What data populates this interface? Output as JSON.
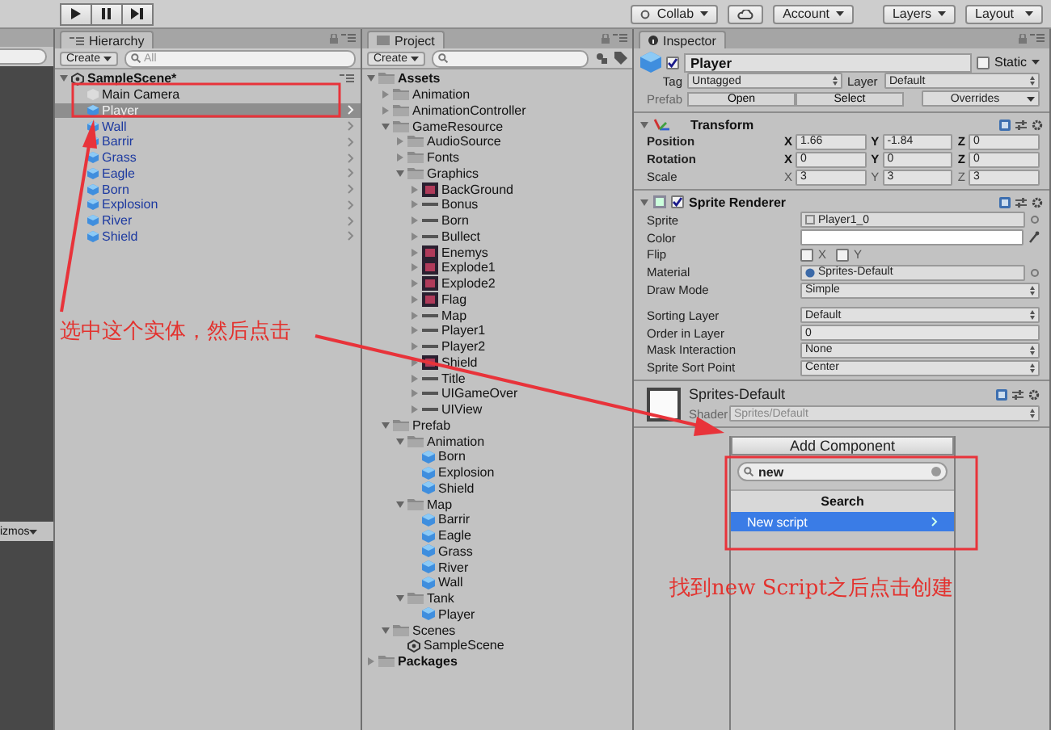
{
  "toolbar": {
    "playback": [
      {
        "kind": "play"
      },
      {
        "kind": "pause"
      },
      {
        "kind": "step"
      }
    ],
    "collab": "Collab",
    "account": "Account",
    "layers": "Layers",
    "layout": "Layout"
  },
  "scene_view": {
    "gizmos": "izmos"
  },
  "hierarchy": {
    "tab": "Hierarchy",
    "create": "Create",
    "search_placeholder": "All",
    "scene": "SampleScene*",
    "items": [
      {
        "label": "Main Camera",
        "kind": "object",
        "selected": false
      },
      {
        "label": "Player",
        "kind": "prefab",
        "selected": true
      },
      {
        "label": "Wall",
        "kind": "prefab",
        "selected": false
      },
      {
        "label": "Barrir",
        "kind": "prefab",
        "selected": false
      },
      {
        "label": "Grass",
        "kind": "prefab",
        "selected": false
      },
      {
        "label": "Eagle",
        "kind": "prefab",
        "selected": false
      },
      {
        "label": "Born",
        "kind": "prefab",
        "selected": false
      },
      {
        "label": "Explosion",
        "kind": "prefab",
        "selected": false
      },
      {
        "label": "River",
        "kind": "prefab",
        "selected": false
      },
      {
        "label": "Shield",
        "kind": "prefab",
        "selected": false
      }
    ]
  },
  "project": {
    "tab": "Project",
    "create": "Create",
    "tree": [
      {
        "label": "Assets",
        "kind": "folder",
        "expanded": true,
        "children": [
          {
            "label": "Animation",
            "kind": "folder",
            "expanded": false
          },
          {
            "label": "AnimationController",
            "kind": "folder",
            "expanded": false
          },
          {
            "label": "GameResource",
            "kind": "folder",
            "expanded": true,
            "children": [
              {
                "label": "AudioSource",
                "kind": "folder",
                "expanded": false
              },
              {
                "label": "Fonts",
                "kind": "folder",
                "expanded": false
              },
              {
                "label": "Graphics",
                "kind": "folder",
                "expanded": true,
                "children": [
                  {
                    "label": "BackGround",
                    "kind": "texture",
                    "expanded": false
                  },
                  {
                    "label": "Bonus",
                    "kind": "strip",
                    "expanded": false
                  },
                  {
                    "label": "Born",
                    "kind": "strip",
                    "expanded": false
                  },
                  {
                    "label": "Bullect",
                    "kind": "strip",
                    "expanded": false
                  },
                  {
                    "label": "Enemys",
                    "kind": "texture",
                    "expanded": false
                  },
                  {
                    "label": "Explode1",
                    "kind": "texture",
                    "expanded": false
                  },
                  {
                    "label": "Explode2",
                    "kind": "texture",
                    "expanded": false
                  },
                  {
                    "label": "Flag",
                    "kind": "texture",
                    "expanded": false
                  },
                  {
                    "label": "Map",
                    "kind": "strip",
                    "expanded": false
                  },
                  {
                    "label": "Player1",
                    "kind": "strip",
                    "expanded": false
                  },
                  {
                    "label": "Player2",
                    "kind": "strip",
                    "expanded": false
                  },
                  {
                    "label": "Shield",
                    "kind": "texture",
                    "expanded": false
                  },
                  {
                    "label": "Title",
                    "kind": "strip",
                    "expanded": false
                  },
                  {
                    "label": "UIGameOver",
                    "kind": "strip",
                    "expanded": false
                  },
                  {
                    "label": "UIView",
                    "kind": "strip",
                    "expanded": false
                  }
                ]
              }
            ]
          },
          {
            "label": "Prefab",
            "kind": "folder",
            "expanded": true,
            "children": [
              {
                "label": "Animation",
                "kind": "folder",
                "expanded": true,
                "children": [
                  {
                    "label": "Born",
                    "kind": "prefab"
                  },
                  {
                    "label": "Explosion",
                    "kind": "prefab"
                  },
                  {
                    "label": "Shield",
                    "kind": "prefab"
                  }
                ]
              },
              {
                "label": "Map",
                "kind": "folder",
                "expanded": true,
                "children": [
                  {
                    "label": "Barrir",
                    "kind": "prefab"
                  },
                  {
                    "label": "Eagle",
                    "kind": "prefab"
                  },
                  {
                    "label": "Grass",
                    "kind": "prefab"
                  },
                  {
                    "label": "River",
                    "kind": "prefab"
                  },
                  {
                    "label": "Wall",
                    "kind": "prefab"
                  }
                ]
              },
              {
                "label": "Tank",
                "kind": "folder",
                "expanded": true,
                "children": [
                  {
                    "label": "Player",
                    "kind": "prefab"
                  }
                ]
              }
            ]
          },
          {
            "label": "Scenes",
            "kind": "folder",
            "expanded": true,
            "children": [
              {
                "label": "SampleScene",
                "kind": "scene"
              }
            ]
          }
        ]
      },
      {
        "label": "Packages",
        "kind": "folder",
        "expanded": false
      }
    ]
  },
  "inspector": {
    "tab": "Inspector",
    "object": {
      "name": "Player",
      "active": true,
      "static_label": "Static",
      "static": false,
      "tag_label": "Tag",
      "tag": "Untagged",
      "layer_label": "Layer",
      "layer": "Default",
      "prefab_label": "Prefab",
      "prefab_buttons": [
        "Open",
        "Select"
      ],
      "overrides": "Overrides"
    },
    "components": [
      {
        "kind": "transform",
        "title": "Transform",
        "expanded": true,
        "rows": [
          {
            "kind": "vector",
            "label": "Position",
            "overridden": true,
            "axes": [
              {
                "axis": "X",
                "value": "1.66"
              },
              {
                "axis": "Y",
                "value": "-1.84"
              },
              {
                "axis": "Z",
                "value": "0"
              }
            ]
          },
          {
            "kind": "vector",
            "label": "Rotation",
            "overridden": true,
            "axes": [
              {
                "axis": "X",
                "value": "0"
              },
              {
                "axis": "Y",
                "value": "0"
              },
              {
                "axis": "Z",
                "value": "0"
              }
            ]
          },
          {
            "kind": "vector",
            "label": "Scale",
            "overridden": false,
            "axes": [
              {
                "axis": "X",
                "value": "3"
              },
              {
                "axis": "Y",
                "value": "3"
              },
              {
                "axis": "Z",
                "value": "3"
              }
            ]
          }
        ]
      },
      {
        "kind": "sprite_renderer",
        "title": "Sprite Renderer",
        "expanded": true,
        "enabled": true,
        "rows": [
          {
            "kind": "sprite",
            "label": "Sprite",
            "value": "Player1_0"
          },
          {
            "kind": "color",
            "label": "Color"
          },
          {
            "kind": "flip",
            "label": "Flip",
            "toggles": [
              {
                "label": "X",
                "checked": false
              },
              {
                "label": "Y",
                "checked": false
              }
            ]
          },
          {
            "kind": "material",
            "label": "Material",
            "value": "Sprites-Default"
          },
          {
            "kind": "dropdown",
            "label": "Draw Mode",
            "value": "Simple"
          },
          {
            "kind": "spacer"
          },
          {
            "kind": "dropdown",
            "label": "Sorting Layer",
            "value": "Default"
          },
          {
            "kind": "text",
            "label": "Order in Layer",
            "value": "0"
          },
          {
            "kind": "dropdown",
            "label": "Mask Interaction",
            "value": "None"
          },
          {
            "kind": "dropdown",
            "label": "Sprite Sort Point",
            "value": "Center"
          }
        ]
      }
    ],
    "material": {
      "name": "Sprites-Default",
      "shader_label": "Shader",
      "shader": "Sprites/Default"
    },
    "add_component": {
      "button": "Add Component",
      "search_value": "new",
      "header": "Search",
      "results": [
        {
          "label": "New script",
          "selected": true
        }
      ]
    }
  },
  "annotations": [
    {
      "kind": "note",
      "text": "选中这个实体，然后点击"
    },
    {
      "kind": "note",
      "text": "找到new Script之后点击创建"
    }
  ]
}
